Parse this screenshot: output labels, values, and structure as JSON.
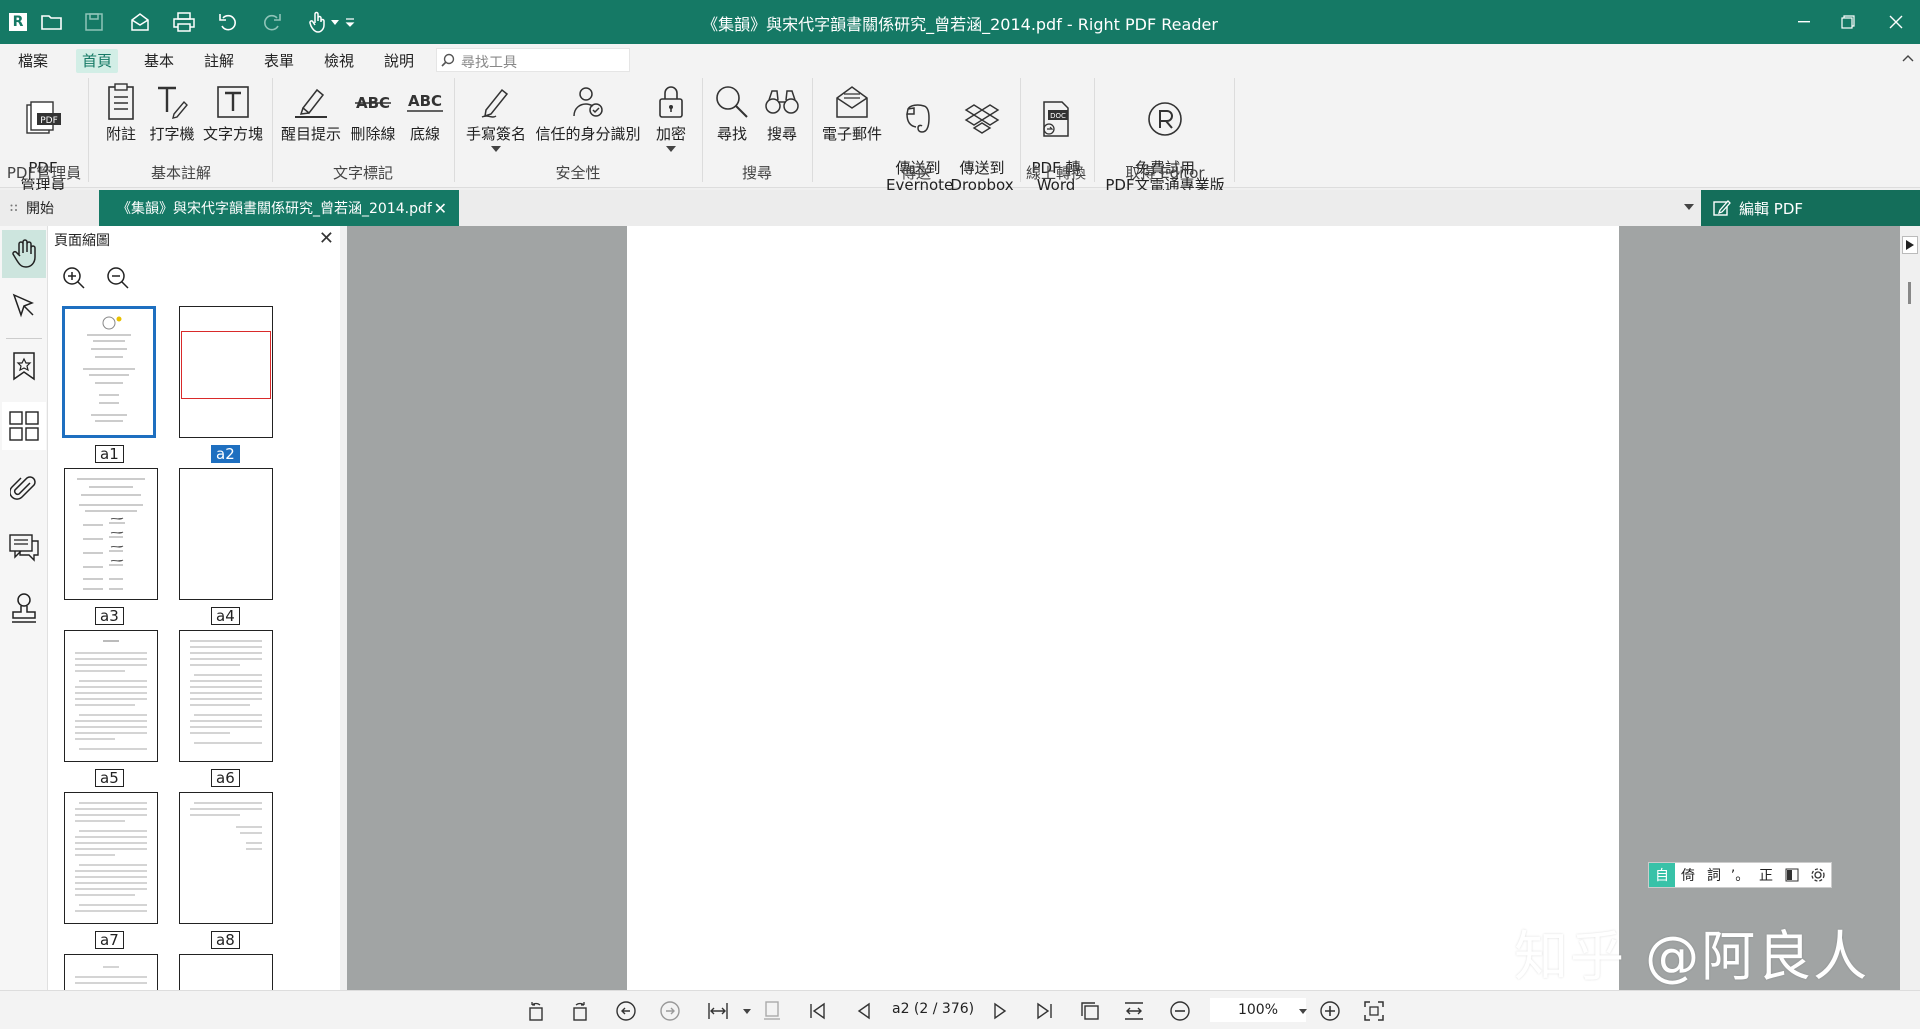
{
  "titlebar": {
    "title": "《集韻》與宋代字韻書關係研究_曾若涵_2014.pdf - Right PDF Reader",
    "app_icon": "R"
  },
  "menu": {
    "items": [
      "檔案",
      "首頁",
      "基本",
      "註解",
      "表單",
      "檢視",
      "說明"
    ],
    "active": "首頁",
    "search_placeholder": "尋找工具"
  },
  "ribbon": {
    "pdf_manager": "PDF\n管理員",
    "g1": "PDF管理員",
    "note": "附註",
    "typewriter": "打字機",
    "textbox": "文字方塊",
    "g2": "基本註解",
    "highlight": "醒目提示",
    "strikeout": "刪除線",
    "underline": "底線",
    "g3": "文字標記",
    "sign": "手寫簽名",
    "trusted_id": "信任的身分識別",
    "encrypt": "加密",
    "g4": "安全性",
    "find": "尋找",
    "search": "搜尋",
    "g5": "搜尋",
    "email": "電子郵件",
    "evernote": "傳送到\nEvernote",
    "dropbox": "傳送到\nDropbox",
    "g6": "傳送",
    "pdf2word": "PDF 轉\nWord",
    "g7": "線上轉換",
    "trial": "免費試用\nPDF文電通專業版",
    "g8": "取得 Editor"
  },
  "tabs": {
    "start": "開始",
    "doc": "《集韻》與宋代字韻書關係研究_曾若涵_2014.pdf",
    "edit_pdf": "編輯 PDF"
  },
  "thumbs": {
    "title": "頁面縮圖",
    "labels": [
      "a1",
      "a2",
      "a3",
      "a4",
      "a5",
      "a6",
      "a7",
      "a8"
    ]
  },
  "status": {
    "page_indicator": "a2 (2 / 376)",
    "zoom": "100%"
  },
  "ime": [
    "自",
    "倚",
    "詞",
    "’。",
    "正"
  ],
  "watermark": "知乎 @阿良人"
}
